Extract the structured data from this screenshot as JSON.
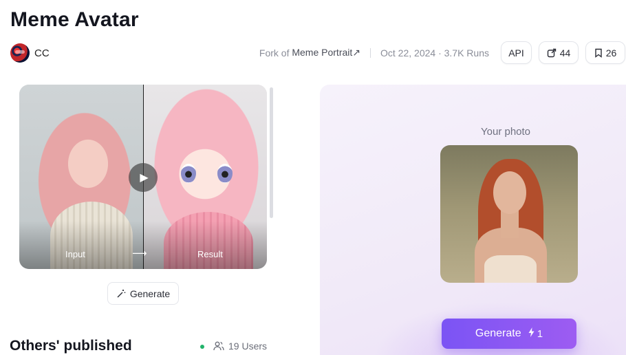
{
  "header": {
    "title": "Meme Avatar",
    "author": "CC",
    "fork_prefix": "Fork of",
    "fork_name": "Meme Portrait",
    "fork_icon": "external-link-arrow",
    "date_runs": "Oct 22, 2024 · 3.7K Runs",
    "api_label": "API",
    "share_count": "44",
    "bookmark_count": "26"
  },
  "preview": {
    "input_label": "Input",
    "arrow": "⟶",
    "result_label": "Result",
    "play_icon": "play-icon"
  },
  "generate_small_label": "Generate",
  "others": {
    "title": "Others' published",
    "users_label": "19 Users",
    "online_color": "#22b36b"
  },
  "panel": {
    "your_photo_label": "Your photo",
    "generate_label": "Generate",
    "cost": "1",
    "accent": "#7b54f4"
  }
}
